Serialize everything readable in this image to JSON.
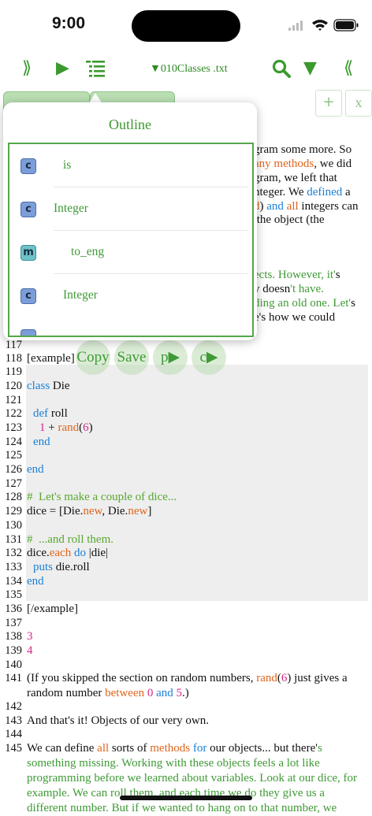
{
  "status": {
    "time": "9:00"
  },
  "toolbar": {
    "left_chevrons": "⟫",
    "run": "▶",
    "filename": "▼010Classes .txt",
    "down": "▼",
    "right_chevrons": "⟪"
  },
  "tabs": {
    "add": "+",
    "close": "x"
  },
  "outline": {
    "title": "Outline",
    "items": [
      {
        "badge": "c",
        "label": "is"
      },
      {
        "badge": "c",
        "label": "Integer"
      },
      {
        "badge": "m",
        "label": "to_eng"
      },
      {
        "badge": "c",
        "label": "Integer"
      }
    ]
  },
  "float_buttons": {
    "copy": "Copy",
    "save": "Save",
    "p": "p▶",
    "c": "c▶"
  },
  "right_text": {
    "l1": "gram some more. So",
    "l2a": "any methods",
    "l2b": ", we did",
    "l3": "gram, we left that",
    "l4a": "nteger. We ",
    "l4b": "defined",
    "l4c": " a",
    "l5a": "d",
    "l5b": ") ",
    "l5c": "and",
    "l5d": " ",
    "l5e": "all",
    "l5f": " integers can",
    "l6": " the object (the",
    "l7a": "ects. However, it'",
    "l7b": "s",
    "l8a": "y doesn",
    "l8b": "'t have.",
    "l9a": "ding an old one. Let'",
    "l9b": "s",
    "l10": "e's how we could"
  },
  "lines": {
    "n117": "117",
    "n118": "118",
    "t118": "[example]",
    "n119": "119",
    "n120": "120",
    "t120a": "class",
    "t120b": " Die",
    "n121": "121",
    "n122": "122",
    "t122a": "def",
    "t122b": " roll",
    "n123": "123",
    "t123a": "1",
    "t123b": " + ",
    "t123c": "rand",
    "t123d": "(",
    "t123e": "6",
    "t123f": ")",
    "n124": "124",
    "t124": "end",
    "n125": "125",
    "n126": "126",
    "t126": "end",
    "n127": "127",
    "n128": "128",
    "t128": "#  Let's make a couple of dice...",
    "n129": "129",
    "t129a": "dice = [Die.",
    "t129b": "new",
    "t129c": ", Die.",
    "t129d": "new",
    "t129e": "]",
    "n130": "130",
    "n131": "131",
    "t131": "#  ...and roll them.",
    "n132": "132",
    "t132a": "dice.",
    "t132b": "each",
    "t132c": " ",
    "t132d": "do",
    "t132e": " |die|",
    "n133": "133",
    "t133a": "puts",
    "t133b": " die.roll",
    "n134": "134",
    "t134": "end",
    "n135": "135",
    "n136": "136",
    "t136": "[/example]",
    "n137": "137",
    "n138": "138",
    "t138": "3",
    "n139": "139",
    "t139": "4",
    "n140": "140",
    "n141": "141",
    "t141a": "(If you skipped the section on random numbers, ",
    "t141b": "rand",
    "t141c": "(",
    "t141d": "6",
    "t141e": ") just gives a random number ",
    "t141f": "between",
    "t141g": " ",
    "t141h": "0",
    "t141i": " ",
    "t141j": "and",
    "t141k": " ",
    "t141l": "5",
    "t141m": ".)",
    "n142": "142",
    "n143": "143",
    "t143": "And that's it! Objects of our very own.",
    "n144": "144",
    "n145": "145",
    "t145a": "We can define ",
    "t145b": "all",
    "t145c": " sorts of ",
    "t145d": "methods",
    "t145e": " ",
    "t145f": "for",
    "t145g": " our objects... but there'",
    "t145h": "s something missing. Working with these objects feels a lot like programming before we learned about variables. Look at our dice, for example. We can roll them, and each time we do they give us a different number. But if we wanted to hang on to that number, we"
  }
}
